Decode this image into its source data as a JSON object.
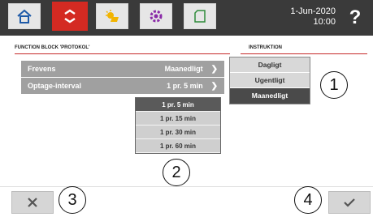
{
  "header": {
    "tabs": [
      {
        "icon": "home-icon"
      },
      {
        "icon": "swap-arrows-icon",
        "active": true
      },
      {
        "icon": "solar-icon"
      },
      {
        "icon": "settings-icon"
      },
      {
        "icon": "document-icon"
      }
    ],
    "date": "1-Jun-2020",
    "time": "10:00",
    "help_label": "?"
  },
  "function_block": {
    "title": "FUNCTION BLOCK 'PROTOKOL'",
    "rows": [
      {
        "label": "Frevens",
        "value": "Maanedligt"
      },
      {
        "label": "Optage-interval",
        "value": "1 pr. 5 min"
      }
    ],
    "interval_options": [
      "1 pr. 5 min",
      "1 pr. 15 min",
      "1 pr. 30 min",
      "1 pr. 60 min"
    ],
    "interval_selected": "1 pr. 5 min"
  },
  "instruktion": {
    "title": "INSTRUKTION",
    "options": [
      "Dagligt",
      "Ugentligt",
      "Maanedligt"
    ],
    "selected": "Maanedligt"
  },
  "callouts": [
    "1",
    "2",
    "3",
    "4"
  ],
  "footer": {
    "cancel_icon": "close-icon",
    "confirm_icon": "checkmark-icon"
  },
  "colors": {
    "topbar": "#3a3a3a",
    "accent_red": "#d42a22",
    "row_gray": "#a0a0a0",
    "selected_dark": "#4a4a4a"
  }
}
